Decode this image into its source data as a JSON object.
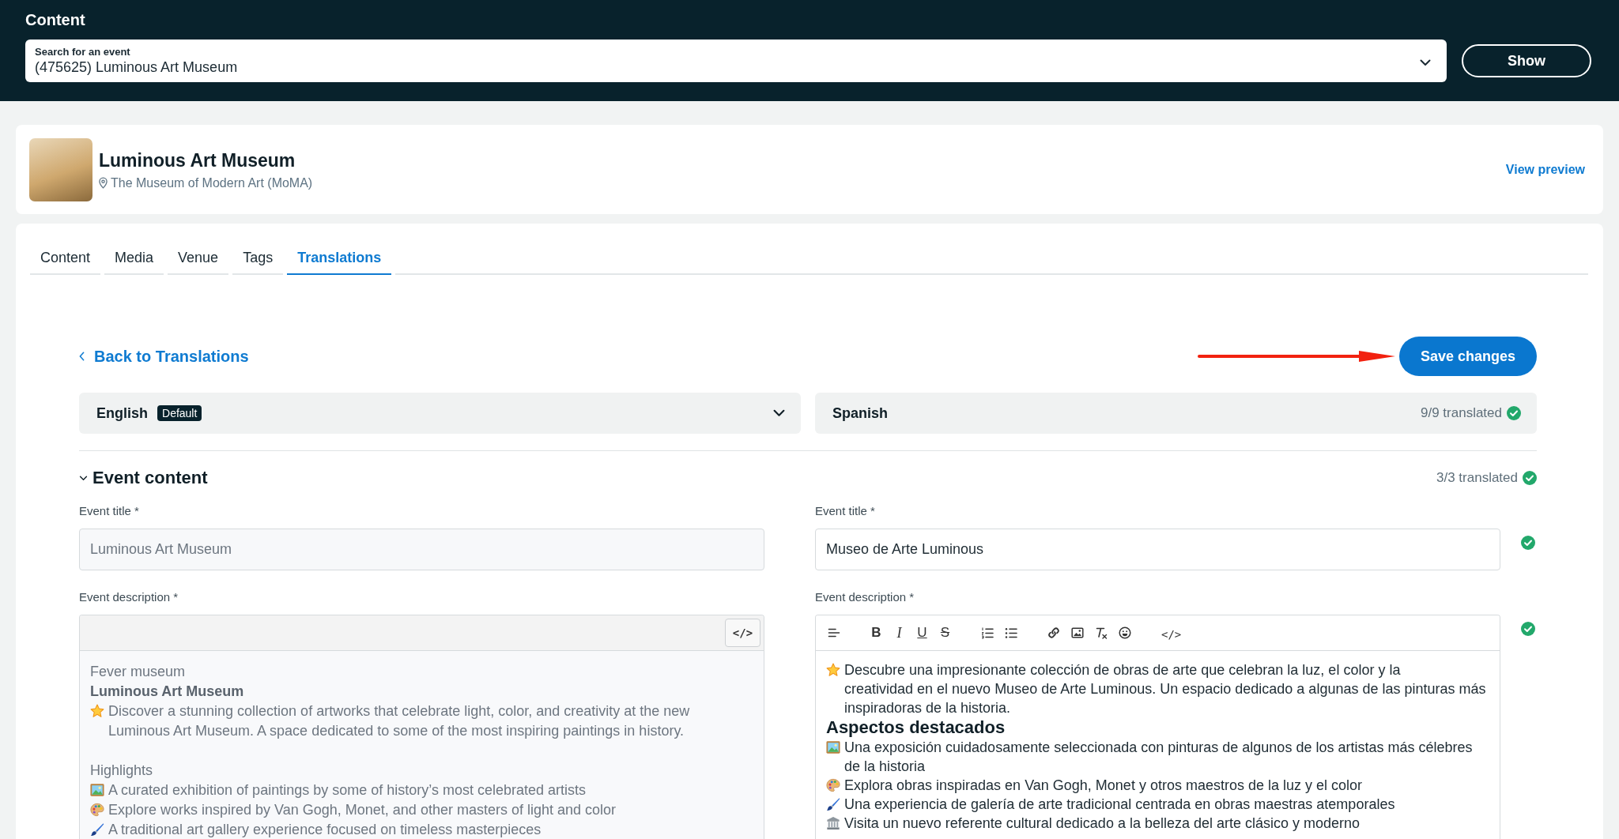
{
  "top_bar": {
    "title": "Content",
    "search": {
      "label": "Search for an event",
      "value": "(475625) Luminous Art Museum"
    },
    "show_button": "Show"
  },
  "event_header": {
    "title": "Luminous Art Museum",
    "venue": "The Museum of Modern Art (MoMA)",
    "preview_link": "View preview"
  },
  "tabs": [
    {
      "label": "Content",
      "selected": false
    },
    {
      "label": "Media",
      "selected": false
    },
    {
      "label": "Venue",
      "selected": false
    },
    {
      "label": "Tags",
      "selected": false
    },
    {
      "label": "Translations",
      "selected": true
    }
  ],
  "translation_editor": {
    "back_link": "Back to Translations",
    "save_button": "Save changes",
    "source_language": {
      "name": "English",
      "badge": "Default"
    },
    "target_language": {
      "name": "Spanish",
      "progress": "9/9 translated",
      "complete": true
    },
    "section": {
      "title": "Event content",
      "expanded": true,
      "progress": "3/3 translated",
      "complete": true,
      "fields": [
        {
          "kind": "input",
          "label": "Event title *",
          "source_value": "Luminous Art Museum",
          "target_label": "Event title *",
          "target_value": "Museo de Arte Luminous",
          "translated": true
        },
        {
          "kind": "rich_text",
          "label": "Event description *",
          "target_label": "Event description *",
          "translated": true,
          "source": {
            "code_button": "</>",
            "paragraphs": [
              {
                "lines": [
                  {
                    "kind": "plain",
                    "text": "Fever museum"
                  },
                  {
                    "kind": "bold",
                    "text": "Luminous Art Museum"
                  },
                  {
                    "kind": "emoji",
                    "text": "Discover a stunning collection of artworks that celebrate light, color, and creativity at the new Luminous Art Museum. A space dedicated to some of the most inspiring paintings in history."
                  }
                ]
              },
              {
                "lines": [
                  {
                    "kind": "plain",
                    "text": "Highlights"
                  },
                  {
                    "kind": "emoji",
                    "text": "A curated exhibition of paintings by some of history’s most celebrated artists"
                  },
                  {
                    "kind": "emoji",
                    "text": "Explore works inspired by Van Gogh, Monet, and other masters of light and color"
                  },
                  {
                    "kind": "emoji",
                    "text": "A traditional art gallery experience focused on timeless masterpieces"
                  }
                ]
              }
            ]
          },
          "target": {
            "format_buttons": [
              {
                "kind": "bold",
                "label": "B"
              },
              {
                "kind": "italic",
                "label": "I"
              },
              {
                "kind": "underline",
                "label": "U"
              },
              {
                "kind": "strike",
                "label": "S"
              }
            ],
            "code_button": "</>",
            "blocks": [
              {
                "kind": "emoji",
                "text": "Descubre una impresionante colección de obras de arte que celebran la luz, el color y la\ncreatividad en el nuevo Museo de Arte Luminous. Un espacio dedicado a algunas de las pinturas más inspiradoras de la historia."
              },
              {
                "kind": "heading",
                "text": "Aspectos destacados"
              },
              {
                "kind": "emoji",
                "text": "Una exposición cuidadosamente seleccionada con pinturas de algunos de los artistas más célebres de la historia"
              },
              {
                "kind": "emoji",
                "text": "Explora obras inspiradas en Van Gogh, Monet y otros maestros de la luz y el color"
              },
              {
                "kind": "emoji",
                "text": "Una experiencia de galería de arte tradicional centrada en obras maestras atemporales"
              },
              {
                "kind": "emoji",
                "text": "Visita un nuevo referente cultural dedicado a la belleza del arte clásico y moderno"
              }
            ]
          }
        }
      ]
    }
  }
}
